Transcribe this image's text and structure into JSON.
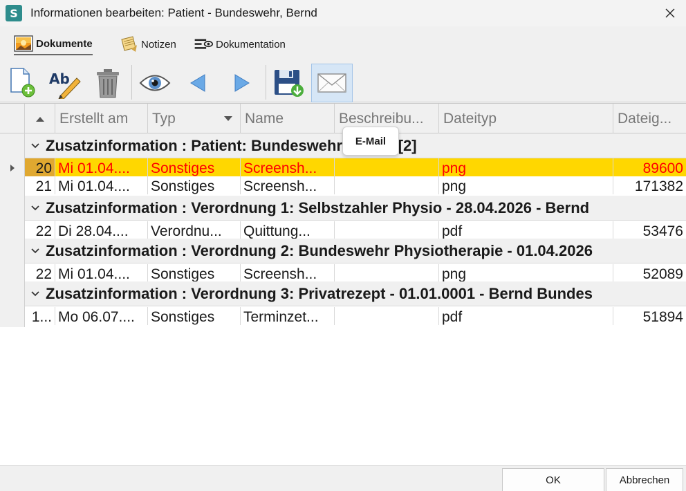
{
  "window": {
    "app_icon_letter": "S",
    "title": "Informationen bearbeiten: Patient - Bundeswehr, Bernd"
  },
  "tabs": [
    {
      "label": "Dokumente",
      "icon": "picture-icon",
      "active": true
    },
    {
      "label": "Notizen",
      "icon": "notes-icon",
      "active": false
    },
    {
      "label": "Dokumentation",
      "icon": "documentation-icon",
      "active": false
    }
  ],
  "toolbar": {
    "buttons": [
      "add-document-icon",
      "rename-icon",
      "delete-icon",
      "view-icon",
      "previous-icon",
      "next-icon",
      "save-icon",
      "email-icon"
    ],
    "tooltip": "E-Mail"
  },
  "grid": {
    "columns": [
      "Erstellt am",
      "Typ",
      "Name",
      "Beschreibu...",
      "Dateityp",
      "Dateig..."
    ],
    "groups": [
      {
        "title": "Zusatzinformation : Patient: Bundeswehr, Bernd [2]",
        "rows": [
          {
            "id": "20",
            "date": "Mi 01.04....",
            "type": "Sonstiges",
            "name": "Screensh...",
            "desc": "",
            "filetype": "png",
            "size": "89600",
            "selected": true
          },
          {
            "id": "21",
            "date": "Mi 01.04....",
            "type": "Sonstiges",
            "name": "Screensh...",
            "desc": "",
            "filetype": "png",
            "size": "171382",
            "selected": false
          }
        ]
      },
      {
        "title": "Zusatzinformation : Verordnung 1: Selbstzahler Physio - 28.04.2026 - Bernd",
        "rows": [
          {
            "id": "22",
            "date": "Di 28.04....",
            "type": "Verordnu...",
            "name": "Quittung...",
            "desc": "",
            "filetype": "pdf",
            "size": "53476",
            "selected": false
          }
        ]
      },
      {
        "title": "Zusatzinformation : Verordnung 2: Bundeswehr Physiotherapie - 01.04.2026",
        "rows": [
          {
            "id": "22",
            "date": "Mi 01.04....",
            "type": "Sonstiges",
            "name": "Screensh...",
            "desc": "",
            "filetype": "png",
            "size": "52089",
            "selected": false
          }
        ]
      },
      {
        "title": "Zusatzinformation : Verordnung 3: Privatrezept - 01.01.0001 - Bernd Bundes",
        "rows": [
          {
            "id": "1...",
            "date": "Mo 06.07....",
            "type": "Sonstiges",
            "name": "Terminzet...",
            "desc": "",
            "filetype": "pdf",
            "size": "51894",
            "selected": false
          }
        ]
      }
    ]
  },
  "footer": {
    "ok_label": "OK",
    "cancel_label": "Abbrechen"
  },
  "colors": {
    "selected_row_bg": "#ffd700",
    "selected_row_text": "#ff0000",
    "app_icon_bg": "#2e8c8c"
  }
}
